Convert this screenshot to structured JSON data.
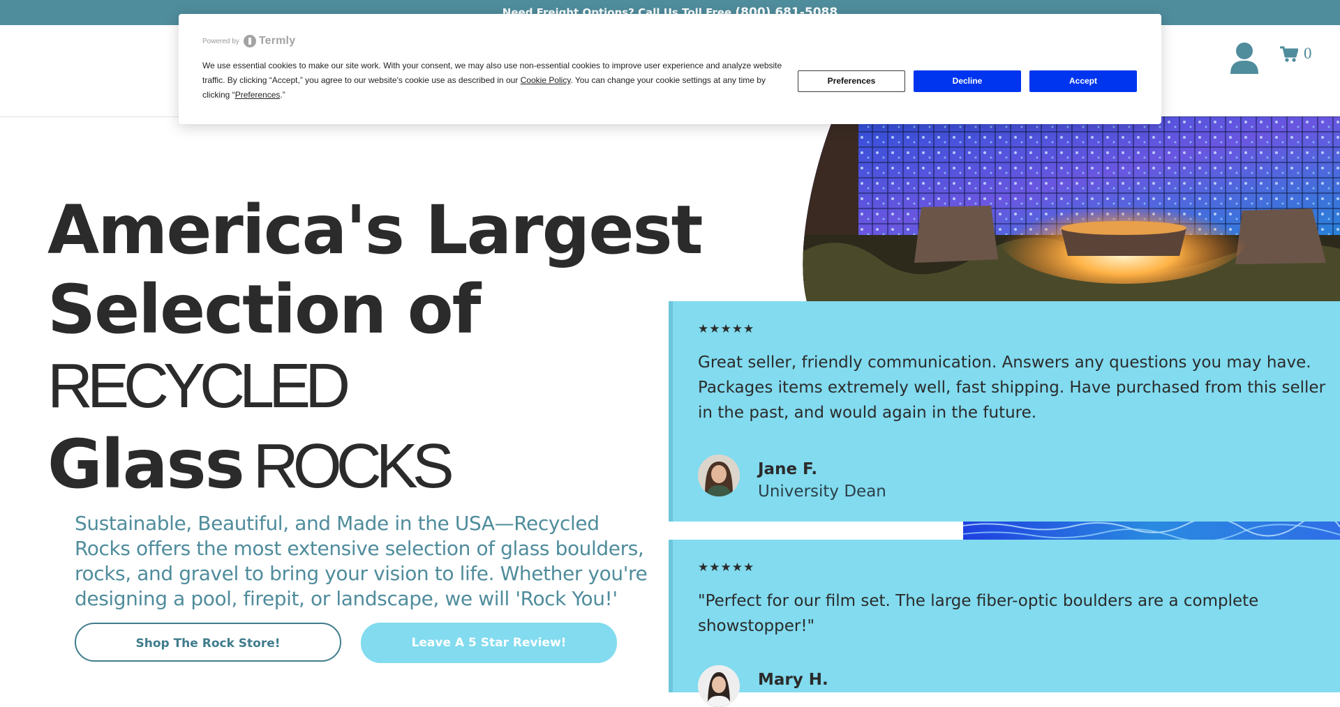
{
  "announcement": {
    "text": "Need Freight Options? Call Us Toll Free",
    "phone": "(800) 681-5088"
  },
  "header": {
    "account_icon": "user-icon",
    "cart_icon": "shopping-cart-icon",
    "cart_count": "0"
  },
  "hero": {
    "title_line_1": "America's Largest",
    "title_line_2": "Selection of",
    "title_line_3": "RECYCLED",
    "title_line_4_bold": "Glass",
    "title_line_4_thin": "ROCKS",
    "description": "Sustainable, Beautiful, and Made in the USA—Recycled Rocks offers the most extensive selection of glass boulders, rocks, and gravel to bring your vision to life. Whether you're designing a pool, firepit, or landscape, we will 'Rock You!'",
    "shop_button": "Shop The Rock Store!",
    "review_button": "Leave A 5 Star Review!"
  },
  "reviews": [
    {
      "stars": "★★★★★",
      "text": "Great seller, friendly communication. Answers any questions you may have. Packages items extremely well, fast shipping. Have purchased from this seller in the past, and would again in the future.",
      "name": "Jane F.",
      "role": "University Dean"
    },
    {
      "stars": "★★★★★",
      "text": "\"Perfect for our film set. The large fiber-optic boulders are a complete showstopper!\"",
      "name": "Mary H."
    }
  ],
  "cookie_banner": {
    "powered_by": "Powered by",
    "brand": "Termly",
    "text_1": "We use essential cookies to make our site work. With your consent, we may also use non-essential cookies to improve user experience and analyze website traffic. By clicking “Accept,” you agree to our website's cookie use as described in our ",
    "cookie_policy_link": "Cookie Policy",
    "text_2": ". You can change your cookie settings at any time by clicking “",
    "preferences_link": "Preferences",
    "text_3": ".”",
    "preferences_button": "Preferences",
    "decline_button": "Decline",
    "accept_button": "Accept"
  },
  "colors": {
    "brand_teal": "#4f8c9c",
    "card_blue": "#82dbef",
    "consent_blue": "#0035ef"
  }
}
